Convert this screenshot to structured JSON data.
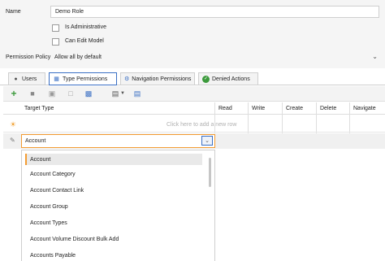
{
  "form": {
    "name_label": "Name",
    "name_value": "Demo Role",
    "is_admin_label": "Is Administrative",
    "can_edit_model_label": "Can Edit Model",
    "permission_policy_label": "Permission Policy",
    "permission_policy_value": "Allow all by default"
  },
  "tabs": [
    {
      "label": "Users",
      "icon": "users-icon"
    },
    {
      "label": "Type Permissions",
      "icon": "type-permissions-icon"
    },
    {
      "label": "Navigation Permissions",
      "icon": "navigation-icon"
    },
    {
      "label": "Denied Actions",
      "icon": "denied-actions-icon"
    }
  ],
  "toolbar": {
    "icons": [
      "add-icon",
      "delete-icon",
      "save-icon",
      "calendar-icon",
      "grid-options-icon",
      "link-icon",
      "chevron-down-icon",
      "export-icon"
    ]
  },
  "grid": {
    "columns": [
      "Target Type",
      "Read",
      "Write",
      "Create",
      "Delete",
      "Navigate"
    ],
    "new_row_placeholder": "Click here to add a new row",
    "editing_value": "Account"
  },
  "dropdown": {
    "items": [
      "Account",
      "Account Category",
      "Account Contact Link",
      "Account Group",
      "Account Types",
      "Account Volume Discount Bulk Add",
      "Accounts Payable"
    ],
    "selected_index": 0
  },
  "colors": {
    "accent_orange": "#f39c33",
    "active_tab_border": "#3a6fc4",
    "add_green": "#3c9a3c"
  }
}
